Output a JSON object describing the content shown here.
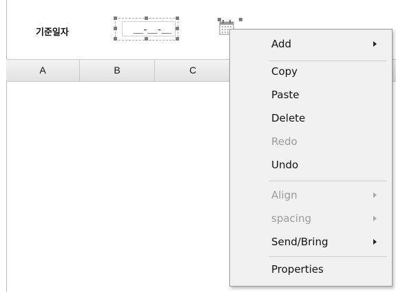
{
  "form": {
    "date_label": "기준일자",
    "date_mask": "__-__-__"
  },
  "grid": {
    "columns": [
      "A",
      "B",
      "C"
    ]
  },
  "context_menu": {
    "items": [
      {
        "label": "Add",
        "enabled": true,
        "submenu": true
      },
      {
        "label": "Copy",
        "enabled": true
      },
      {
        "label": "Paste",
        "enabled": true
      },
      {
        "label": "Delete",
        "enabled": true
      },
      {
        "label": "Redo",
        "enabled": false
      },
      {
        "label": "Undo",
        "enabled": true
      },
      {
        "label": "Align",
        "enabled": false,
        "submenu": true
      },
      {
        "label": "spacing",
        "enabled": false,
        "submenu": true
      },
      {
        "label": "Send/Bring",
        "enabled": true,
        "submenu": true
      },
      {
        "label": "Properties",
        "enabled": true
      }
    ]
  },
  "icons": {
    "calendar": "calendar-icon",
    "submenu_arrow": "chevron-right-icon"
  },
  "colors": {
    "menu_background": "#f1f1f1",
    "disabled_text": "#9a9a9a",
    "header_background": "#e9e9e9"
  }
}
